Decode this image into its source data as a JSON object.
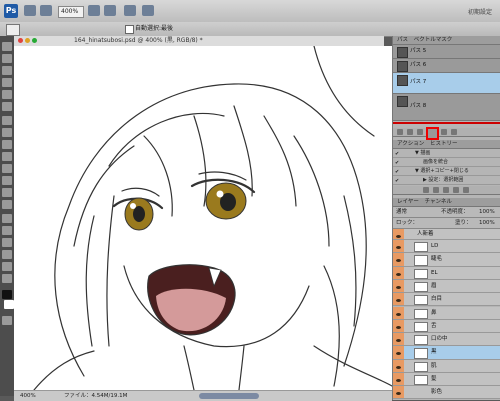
{
  "app": {
    "logo": "Ps",
    "zoom_field": "400%",
    "workspace_label": "初期設定"
  },
  "options_bar": {
    "auto_select_label": "自動選択:最後"
  },
  "document": {
    "tab_title": "164_hinatsubosi.psd @ 400% (黒, RGB/8) *"
  },
  "status_bar": {
    "zoom": "400%",
    "file_info": "ファイル：4.54M/19.1M"
  },
  "paths_panel": {
    "tabs": [
      "パス",
      "ベクトルマスク"
    ],
    "items": [
      {
        "name": "パス 5",
        "selected": false
      },
      {
        "name": "パス 6",
        "selected": false
      },
      {
        "name": "パス 7",
        "selected": true
      },
      {
        "name": "パス 8",
        "selected": false
      }
    ]
  },
  "actions_panel": {
    "tabs": [
      "アクション",
      "ヒストリー"
    ],
    "rows": [
      "▼ 描画",
      "画像を統合",
      "▼ 選択+コピー+閉じる",
      "▶ 設定：選択範囲"
    ]
  },
  "layers_panel": {
    "tabs": [
      "レイヤー",
      "チャンネル"
    ],
    "blend_mode": "通常",
    "opacity_label": "不透明度：",
    "opacity": "100%",
    "lock_label": "ロック：",
    "fill_label": "塗り：",
    "fill": "100%",
    "group_name": "人新着",
    "layers": [
      {
        "name": "LD",
        "selected": false
      },
      {
        "name": "睫毛",
        "selected": false
      },
      {
        "name": "EL",
        "selected": false
      },
      {
        "name": "眉",
        "selected": false
      },
      {
        "name": "白目",
        "selected": false
      },
      {
        "name": "鼻",
        "selected": false
      },
      {
        "name": "舌",
        "selected": false
      },
      {
        "name": "口の中",
        "selected": false
      },
      {
        "name": "黒",
        "selected": true
      },
      {
        "name": "肌",
        "selected": false
      },
      {
        "name": "髪",
        "selected": false
      }
    ],
    "sub_layer": "影色"
  }
}
